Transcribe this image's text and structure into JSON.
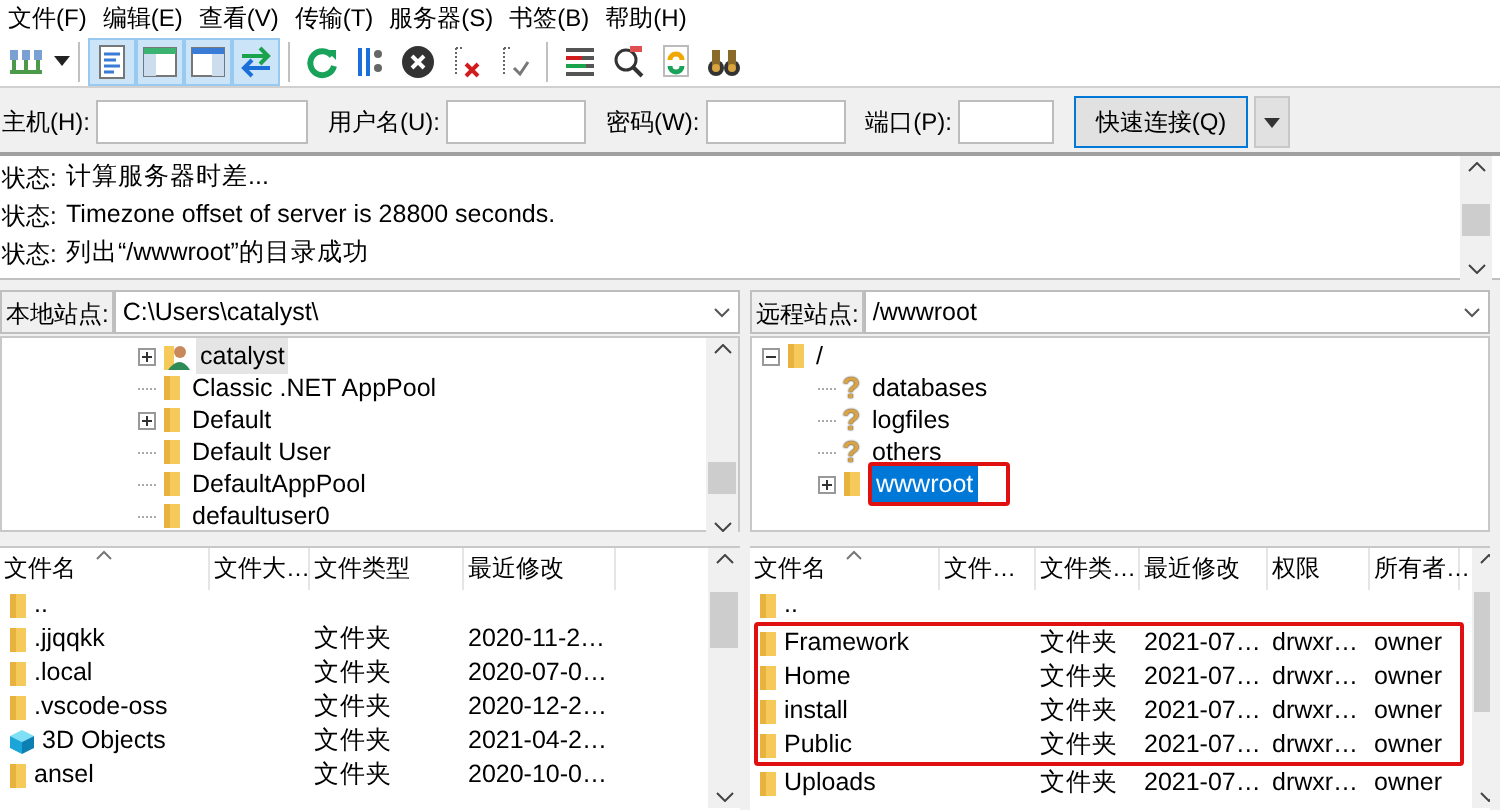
{
  "menu": [
    "文件(F)",
    "编辑(E)",
    "查看(V)",
    "传输(T)",
    "服务器(S)",
    "书签(B)",
    "帮助(H)"
  ],
  "toolbar": [
    {
      "pressed": false
    },
    {
      "pressed": true
    },
    {
      "pressed": true
    },
    {
      "pressed": true
    },
    {
      "pressed": true
    },
    {
      "pressed": false
    },
    {
      "pressed": false
    },
    {
      "pressed": false
    },
    {
      "pressed": false
    },
    {
      "pressed": false
    },
    {
      "pressed": false
    },
    {
      "pressed": false
    },
    {
      "pressed": false
    },
    {
      "pressed": false
    }
  ],
  "quickconnect": {
    "fields": [
      {
        "label": "主机(H):"
      },
      {
        "label": "用户名(U):"
      },
      {
        "label": "密码(W):"
      },
      {
        "label": "端口(P):"
      }
    ],
    "button": "快速连接(Q)"
  },
  "log": [
    {
      "label": "状态:",
      "text": "计算服务器时差..."
    },
    {
      "label": "状态:",
      "text": "Timezone offset of server is 28800 seconds."
    },
    {
      "label": "状态:",
      "text": "列出“/wwwroot”的目录成功"
    }
  ],
  "local": {
    "path_label": "本地站点:",
    "path": "C:\\Users\\catalyst\\",
    "tree": [
      {
        "name": "catalyst",
        "kind": "user",
        "expandable": true,
        "expanded": false,
        "selected": true,
        "annotated": false
      },
      {
        "name": "Classic .NET AppPool",
        "kind": "folder",
        "expandable": false,
        "selected": false,
        "annotated": false
      },
      {
        "name": "Default",
        "kind": "folder",
        "expandable": true,
        "expanded": false,
        "selected": false,
        "annotated": false
      },
      {
        "name": "Default User",
        "kind": "folder",
        "expandable": false,
        "selected": false,
        "annotated": false
      },
      {
        "name": "DefaultAppPool",
        "kind": "folder",
        "expandable": false,
        "selected": false,
        "annotated": false
      },
      {
        "name": "defaultuser0",
        "kind": "folder",
        "expandable": false,
        "selected": false,
        "annotated": false
      }
    ],
    "columns": [
      "文件名",
      "文件大…",
      "文件类型",
      "最近修改"
    ],
    "rows": [
      {
        "kind": "folder",
        "annotated": false,
        "cells": [
          "..",
          "",
          "",
          ""
        ]
      },
      {
        "kind": "folder",
        "annotated": false,
        "cells": [
          ".jjqqkk",
          "",
          "文件夹",
          "2020-11-2…"
        ]
      },
      {
        "kind": "folder",
        "annotated": false,
        "cells": [
          ".local",
          "",
          "文件夹",
          "2020-07-0…"
        ]
      },
      {
        "kind": "folder",
        "annotated": false,
        "cells": [
          ".vscode-oss",
          "",
          "文件夹",
          "2020-12-2…"
        ]
      },
      {
        "kind": "cube",
        "annotated": false,
        "cells": [
          "3D Objects",
          "",
          "文件夹",
          "2021-04-2…"
        ]
      },
      {
        "kind": "folder",
        "annotated": false,
        "cells": [
          "ansel",
          "",
          "文件夹",
          "2020-10-0…"
        ]
      }
    ]
  },
  "remote": {
    "path_label": "远程站点:",
    "path": "/wwwroot",
    "tree": [
      {
        "name": "/",
        "kind": "folder",
        "expandable": true,
        "expanded": true,
        "selected": false,
        "annotated": false,
        "children": [
          {
            "name": "databases",
            "kind": "unknown",
            "glyph": "?",
            "expandable": false,
            "selected": false,
            "annotated": false
          },
          {
            "name": "logfiles",
            "kind": "unknown",
            "glyph": "?",
            "expandable": false,
            "selected": false,
            "annotated": false
          },
          {
            "name": "others",
            "kind": "unknown",
            "glyph": "?",
            "expandable": false,
            "selected": false,
            "annotated": false
          },
          {
            "name": "wwwroot",
            "kind": "folder",
            "expandable": true,
            "expanded": false,
            "selected": true,
            "annotated": true
          }
        ]
      }
    ],
    "columns": [
      "文件名",
      "文件…",
      "文件类…",
      "最近修改",
      "权限",
      "所有者…"
    ],
    "rows": [
      {
        "kind": "folder",
        "annotated": false,
        "cells": [
          "..",
          "",
          "",
          "",
          "",
          ""
        ]
      },
      {
        "kind": "folder",
        "annotated": true,
        "cells": [
          "Framework",
          "",
          "文件夹",
          "2021-07…",
          "drwxr…",
          "owner"
        ]
      },
      {
        "kind": "folder",
        "annotated": true,
        "cells": [
          "Home",
          "",
          "文件夹",
          "2021-07…",
          "drwxr…",
          "owner"
        ]
      },
      {
        "kind": "folder",
        "annotated": true,
        "cells": [
          "install",
          "",
          "文件夹",
          "2021-07…",
          "drwxr…",
          "owner"
        ]
      },
      {
        "kind": "folder",
        "annotated": true,
        "cells": [
          "Public",
          "",
          "文件夹",
          "2021-07…",
          "drwxr…",
          "owner"
        ]
      },
      {
        "kind": "folder",
        "annotated": false,
        "cells": [
          "Uploads",
          "",
          "文件夹",
          "2021-07…",
          "drwxr…",
          "owner"
        ]
      }
    ]
  }
}
